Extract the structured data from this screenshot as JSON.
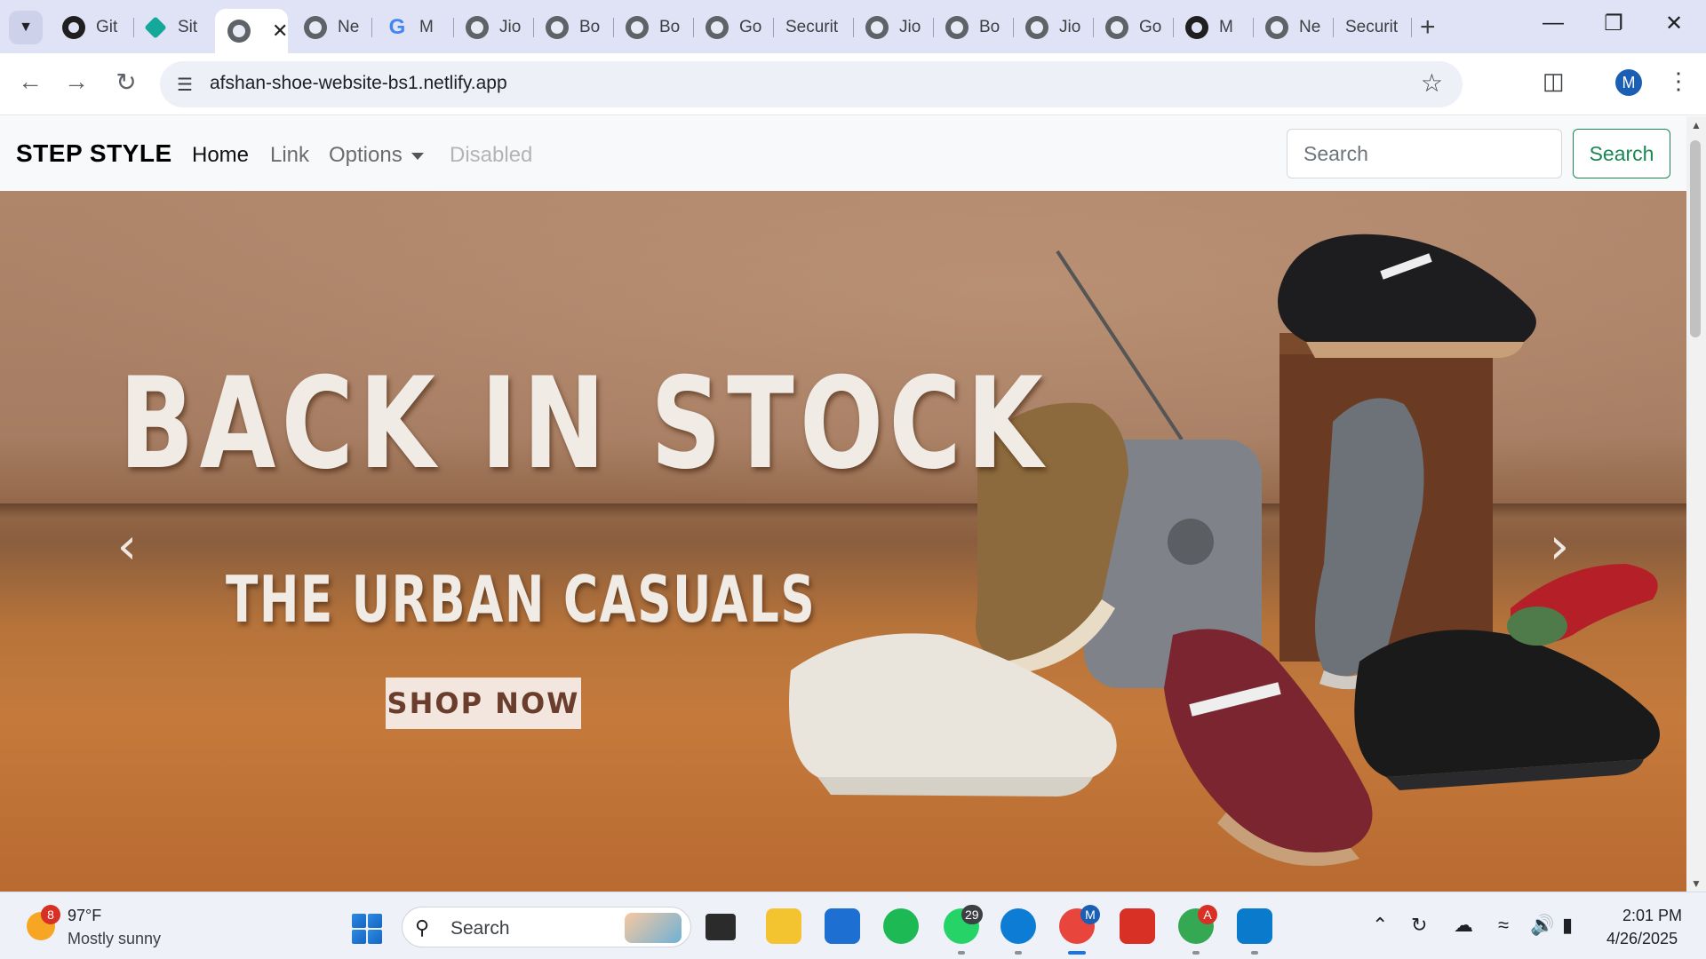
{
  "browser": {
    "tabs": [
      {
        "label": "Git",
        "icon": "github-icon"
      },
      {
        "label": "Sit",
        "icon": "site-icon"
      },
      {
        "label": "",
        "icon": "globe-icon",
        "active": true
      },
      {
        "label": "Ne",
        "icon": "globe-icon"
      },
      {
        "label": "M",
        "icon": "google-icon"
      },
      {
        "label": "Jio",
        "icon": "globe-icon"
      },
      {
        "label": "Bo",
        "icon": "globe-icon"
      },
      {
        "label": "Bo",
        "icon": "globe-icon"
      },
      {
        "label": "Go",
        "icon": "globe-icon"
      },
      {
        "label": "Securit",
        "icon": ""
      },
      {
        "label": "Jio",
        "icon": "globe-icon"
      },
      {
        "label": "Bo",
        "icon": "globe-icon"
      },
      {
        "label": "Jio",
        "icon": "globe-icon"
      },
      {
        "label": "Go",
        "icon": "globe-icon"
      },
      {
        "label": "M",
        "icon": "github-icon"
      },
      {
        "label": "Ne",
        "icon": "globe-icon"
      },
      {
        "label": "Securit",
        "icon": ""
      }
    ],
    "url": "afshan-shoe-website-bs1.netlify.app",
    "profile_initial": "M"
  },
  "site": {
    "brand": "STEP STYLE",
    "nav": {
      "home": "Home",
      "link": "Link",
      "options": "Options",
      "disabled": "Disabled"
    },
    "search": {
      "placeholder": "Search",
      "button": "Search"
    },
    "hero": {
      "headline": "BACK IN STOCK",
      "subhead": "THE URBAN CASUALS",
      "cta": "SHOP NOW",
      "prev": "‹",
      "next": "›"
    }
  },
  "taskbar": {
    "weather": {
      "badge": "8",
      "temp": "97°F",
      "desc": "Mostly sunny"
    },
    "search_label": "Search",
    "whatsapp_badge": "29",
    "chrome_badge": "M",
    "chrome2_badge": "A",
    "time": "2:01 PM",
    "date": "4/26/2025"
  },
  "colors": {
    "search_button": "#198754",
    "accent": "#1a73e8"
  }
}
